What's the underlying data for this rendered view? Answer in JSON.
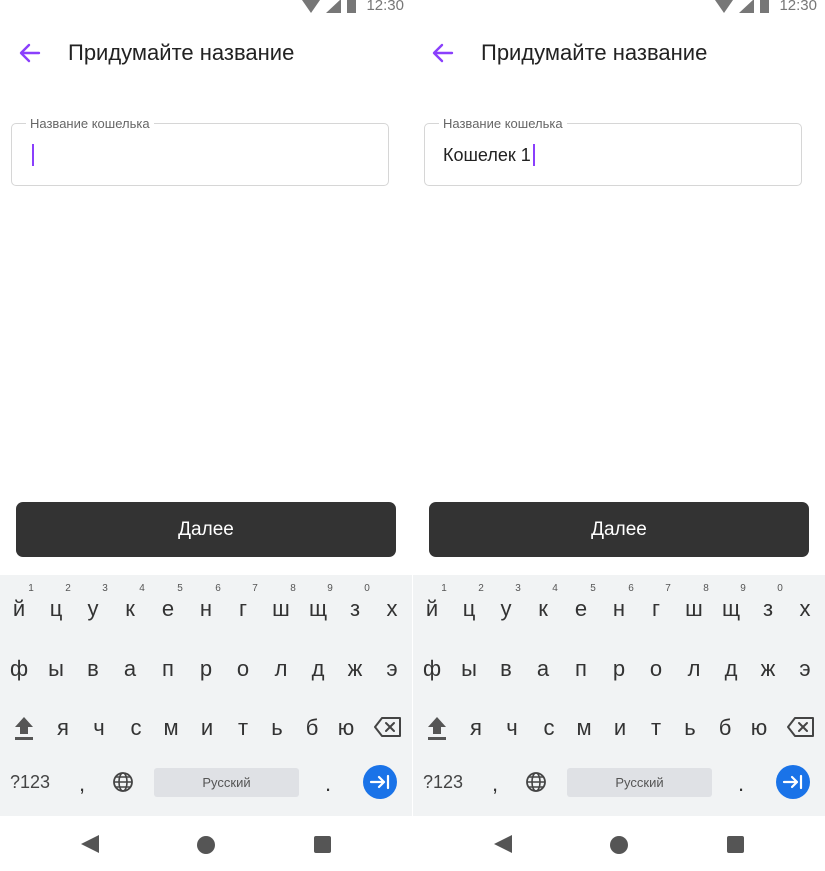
{
  "colors": {
    "accent": "#8a3ffc",
    "button_bg": "#333333",
    "enter_key": "#1a73e8",
    "keyboard_bg": "#f1f3f4"
  },
  "screens": [
    {
      "status": {
        "time": "12:30"
      },
      "header": {
        "title": "Придумайте название"
      },
      "field": {
        "label": "Название кошелька",
        "value": ""
      },
      "primary_button": {
        "label": "Далее"
      }
    },
    {
      "status": {
        "time": "12:30"
      },
      "header": {
        "title": "Придумайте название"
      },
      "field": {
        "label": "Название кошелька",
        "value": "Кошелек 1"
      },
      "primary_button": {
        "label": "Далее"
      }
    }
  ],
  "keyboard": {
    "row1": [
      "й",
      "ц",
      "у",
      "к",
      "е",
      "н",
      "г",
      "ш",
      "щ",
      "з",
      "х"
    ],
    "row1_hints": [
      "1",
      "2",
      "3",
      "4",
      "5",
      "6",
      "7",
      "8",
      "9",
      "0"
    ],
    "row2": [
      "ф",
      "ы",
      "в",
      "а",
      "п",
      "р",
      "о",
      "л",
      "д",
      "ж",
      "э"
    ],
    "row3": [
      "я",
      "ч",
      "с",
      "м",
      "и",
      "т",
      "ь",
      "б",
      "ю"
    ],
    "symbols_key": "?123",
    "comma_key": ",",
    "period_key": ".",
    "space_label": "Русский"
  }
}
